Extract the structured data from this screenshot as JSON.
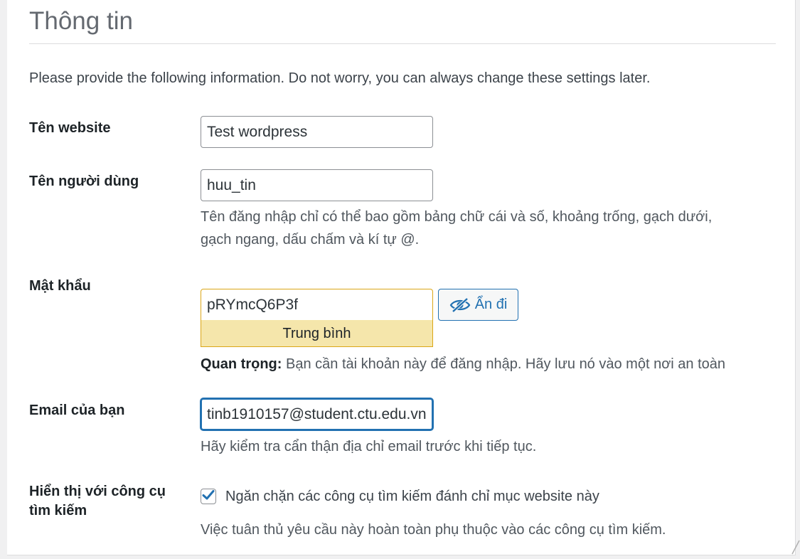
{
  "heading": "Thông tin",
  "intro": "Please provide the following information. Do not worry, you can always change these settings later.",
  "site_title": {
    "label": "Tên website",
    "value": "Test wordpress"
  },
  "username": {
    "label": "Tên người dùng",
    "value": "huu_tin",
    "help_line1": "Tên đăng nhập chỉ có thể bao gồm bảng chữ cái và số, khoảng trống, gạch dưới,",
    "help_line2": "gạch ngang, dấu chấm và kí tự @."
  },
  "password": {
    "label": "Mật khẩu",
    "value": "pRYmcQ6P3f",
    "strength": "Trung bình",
    "hide_button": "Ẩn đi",
    "note_strong": "Quan trọng:",
    "note_text": " Bạn cần tài khoản này để đăng nhập. Hãy lưu nó vào một nơi an toàn"
  },
  "email": {
    "label": "Email của bạn",
    "value": "tinb1910157@student.ctu.edu.vn",
    "help": "Hãy kiểm tra cẩn thận địa chỉ email trước khi tiếp tục."
  },
  "search_visibility": {
    "label_line1": "Hiển thị với công cụ",
    "label_line2": "tìm kiếm",
    "checkbox_label": "Ngăn chặn các công cụ tìm kiếm đánh chỉ mục website này",
    "checked": true,
    "help": "Việc tuân thủ yêu cầu này hoàn toàn phụ thuộc vào các công cụ tìm kiếm."
  },
  "icons": {
    "hide_password": "eye-slash-icon",
    "checkbox": "checkmark-icon"
  },
  "colors": {
    "accent": "#2271b1",
    "strength_bg": "#f5e6ab",
    "strength_border": "#dba617"
  }
}
